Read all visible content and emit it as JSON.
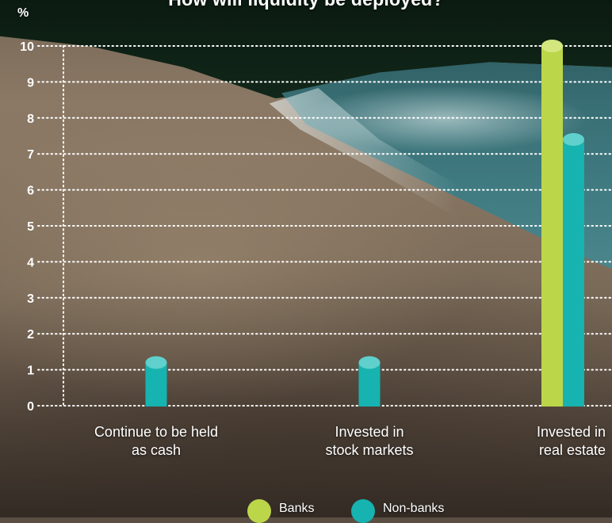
{
  "title": "How will liquidity be deployed?",
  "colors": {
    "banks": "#bcd64a",
    "banks_top": "#d4e77f",
    "nonbanks": "#16b3b0",
    "nonbanks_top": "#5fd0cc"
  },
  "legend": {
    "banks": "Banks",
    "nonbanks": "Non-banks"
  },
  "chart_data": {
    "type": "bar",
    "title": "How will liquidity be deployed?",
    "ylabel": "%",
    "xlabel": "",
    "ylim": [
      0,
      10
    ],
    "yticks": [
      "0",
      "1",
      "2",
      "3",
      "4",
      "5",
      "6",
      "7",
      "8",
      "9",
      "10"
    ],
    "grid": true,
    "legend_position": "bottom",
    "categories": [
      {
        "line1": "Continue to be held",
        "line2": "as cash"
      },
      {
        "line1": "Invested in",
        "line2": "stock markets"
      },
      {
        "line1": "Invested in",
        "line2": "real estate"
      }
    ],
    "series": [
      {
        "name": "Banks",
        "values": [
          0,
          0,
          10
        ]
      },
      {
        "name": "Non-banks",
        "values": [
          1.2,
          1.2,
          7.4
        ]
      }
    ]
  }
}
